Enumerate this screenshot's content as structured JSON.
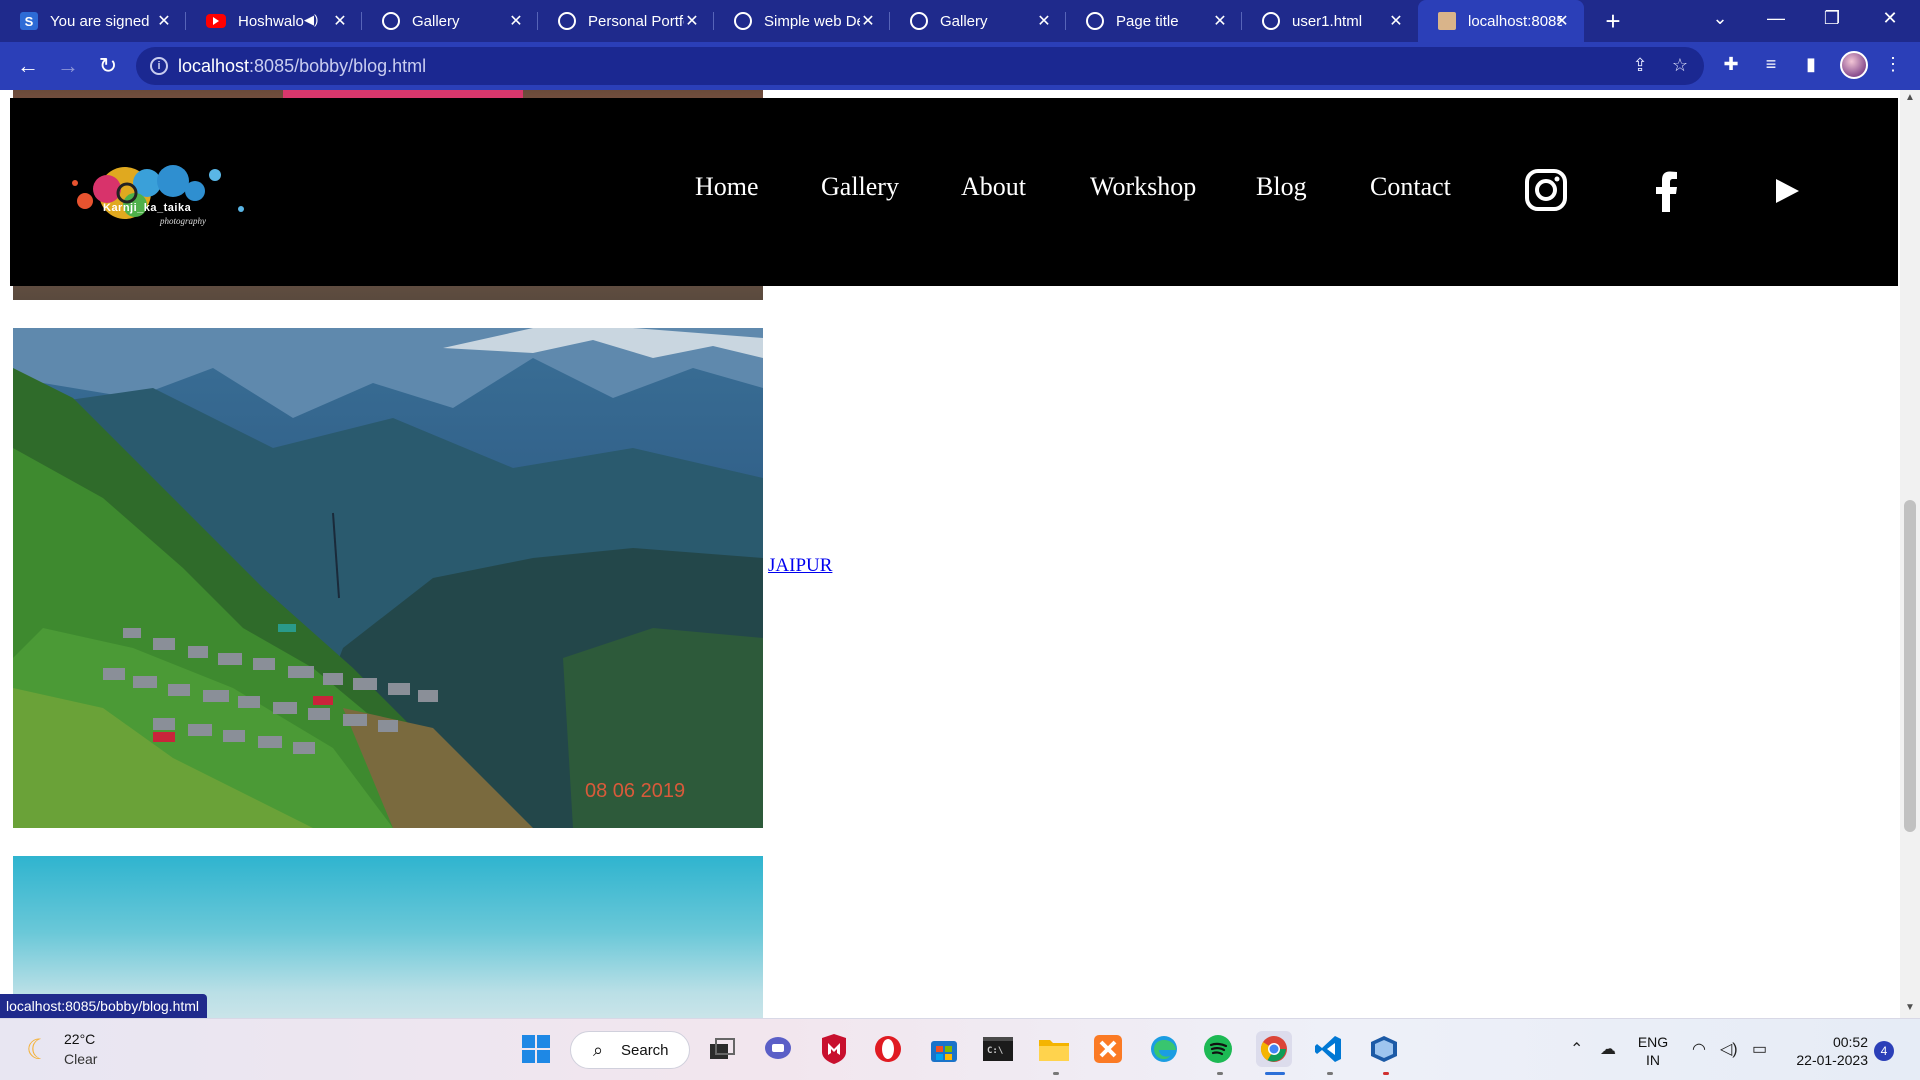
{
  "browser": {
    "tabs": [
      {
        "title": "You are signed",
        "icon": "s-logo-icon"
      },
      {
        "title": "Hoshwalo",
        "icon": "youtube-icon"
      },
      {
        "title": "Gallery",
        "icon": "globe-icon"
      },
      {
        "title": "Personal Portfo",
        "icon": "globe-icon"
      },
      {
        "title": "Simple web De",
        "icon": "globe-icon"
      },
      {
        "title": "Gallery",
        "icon": "globe-icon"
      },
      {
        "title": "Page title",
        "icon": "globe-icon"
      },
      {
        "title": "user1.html",
        "icon": "globe-icon"
      },
      {
        "title": "localhost:8085",
        "icon": "image-icon",
        "active": true
      }
    ],
    "url_host": "localhost",
    "url_path": ":8085/bobby/blog.html",
    "status_tip": "localhost:8085/bobby/blog.html"
  },
  "site": {
    "logo_text": "Karnji_ka_taika",
    "logo_sub": "photography",
    "nav": [
      "Home",
      "Gallery",
      "About",
      "Workshop",
      "Blog",
      "Contact"
    ],
    "social": [
      "instagram-icon",
      "facebook-icon",
      "play-icon"
    ]
  },
  "blog": {
    "entry_caption": "JAIPUR",
    "entry_date": "08 06 2019"
  },
  "taskbar": {
    "weather_temp": "22°C",
    "weather_desc": "Clear",
    "search_label": "Search",
    "lang_line1": "ENG",
    "lang_line2": "IN",
    "time": "00:52",
    "date": "22-01-2023",
    "notification_count": "4"
  }
}
